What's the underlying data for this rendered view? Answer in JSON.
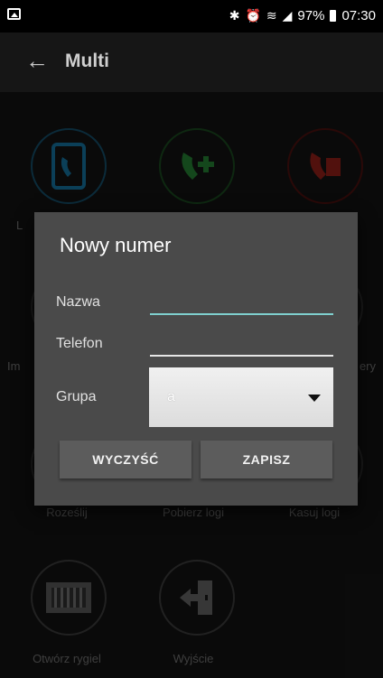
{
  "status_bar": {
    "battery": "97%",
    "time": "07:30"
  },
  "app_bar": {
    "title": "Multi"
  },
  "tiles": [
    {
      "label": "L",
      "icon": "phonebook-icon"
    },
    {
      "label": "",
      "icon": "add-call-icon"
    },
    {
      "label": "",
      "icon": "delete-call-icon"
    },
    {
      "label": "Im",
      "icon": "import-icon"
    },
    {
      "label": "ery",
      "icon": "battery-icon"
    },
    {
      "label": "Roześlij",
      "icon": "send-icon"
    },
    {
      "label": "Pobierz logi",
      "icon": "download-logs-icon"
    },
    {
      "label": "Kasuj logi",
      "icon": "delete-logs-icon"
    },
    {
      "label": "Otwórz rygiel",
      "icon": "gate-icon"
    },
    {
      "label": "Wyjście",
      "icon": "exit-icon"
    }
  ],
  "dialog": {
    "title": "Nowy numer",
    "name_label": "Nazwa",
    "name_value": "",
    "phone_label": "Telefon",
    "phone_value": "",
    "group_label": "Grupa",
    "group_value": "a",
    "clear_button": "WYCZYŚĆ",
    "save_button": "ZAPISZ"
  },
  "colors": {
    "accent": "#7fd0cf",
    "dialog_bg": "#4a4a4a",
    "green": "#2e9e3e",
    "red": "#b3261e",
    "blue": "#1a8dc4"
  }
}
